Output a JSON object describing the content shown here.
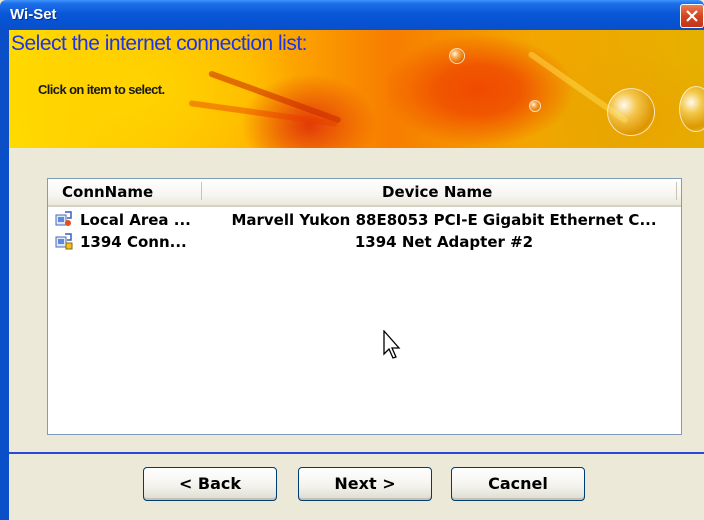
{
  "window": {
    "title": "Wi-Set",
    "close_icon": "close-icon"
  },
  "banner": {
    "title": "Select the internet connection list:",
    "subtitle": "Click on item to select."
  },
  "list": {
    "columns": [
      "ConnName",
      "Device Name"
    ],
    "rows": [
      {
        "conn_name": "Local Area ...",
        "device_name": "Marvell Yukon 88E8053 PCI-E Gigabit Ethernet C...",
        "icon": "network-connection-icon"
      },
      {
        "conn_name": "1394 Conn...",
        "device_name": "1394 Net Adapter #2",
        "icon": "network-connection-icon"
      }
    ]
  },
  "buttons": {
    "back": "< Back",
    "next": "Next >",
    "cancel": "Cacnel"
  },
  "colors": {
    "titlebar": "#0a58d8",
    "banner_title": "#1c34e8",
    "separator": "#2b49d6",
    "dialog_bg": "#ece9d8"
  }
}
